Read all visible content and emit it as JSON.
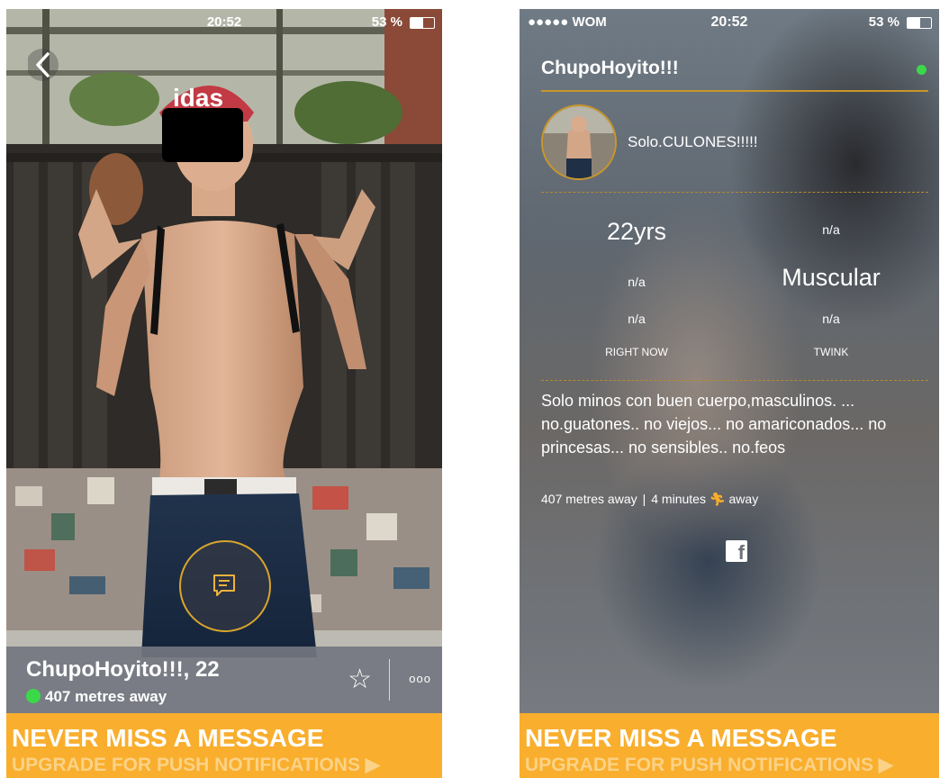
{
  "left": {
    "status_bar": {
      "time": "20:52",
      "battery": "53 %"
    },
    "profile": {
      "name_age": "ChupoHoyito!!!, 22",
      "distance": "407 metres away"
    },
    "actions": {
      "more": "ooo"
    }
  },
  "right": {
    "status_bar": {
      "carrier": "●●●●● WOM",
      "time": "20:52",
      "battery": "53 %"
    },
    "profile": {
      "name": "ChupoHoyito!!!",
      "headline": "Solo.CULONES!!!!!",
      "stats": {
        "age": "22yrs",
        "height": "n/a",
        "weight": "n/a",
        "body_type": "Muscular",
        "ethnicity": "n/a",
        "relationship": "n/a",
        "looking_for": "RIGHT NOW",
        "tribe": "TWINK"
      },
      "about": "Solo minos con buen cuerpo,masculinos.  ... no.guatones.. no viejos... no amariconados... no princesas... no sensibles.. no.feos",
      "distance": "407 metres away",
      "walk_time_prefix": "4 minutes",
      "walk_time_suffix": "away"
    }
  },
  "banner": {
    "title": "NEVER MISS A MESSAGE",
    "subtitle": "UPGRADE FOR PUSH NOTIFICATIONS ▶"
  },
  "colors": {
    "accent": "#f9ae2d",
    "online": "#3bd94a",
    "gold": "#c9962a"
  }
}
